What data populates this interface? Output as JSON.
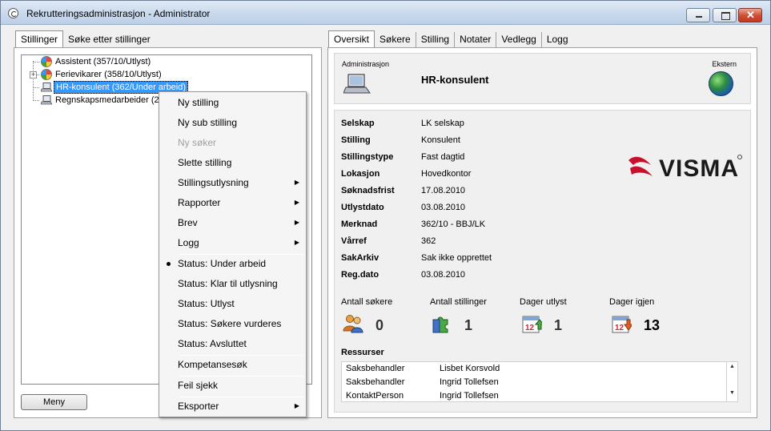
{
  "window": {
    "title": "Rekrutteringsadministrasjon - Administrator"
  },
  "left_tabs": [
    {
      "label": "Stillinger",
      "active": true
    },
    {
      "label": "Søke etter stillinger",
      "active": false
    }
  ],
  "tree": {
    "items": [
      {
        "label": "Assistent (357/10/Utlyst)",
        "icon": "pie-chart-icon",
        "expandable": false,
        "selected": false
      },
      {
        "label": "Ferievikarer (358/10/Utlyst)",
        "icon": "pie-chart-icon",
        "expandable": true,
        "selected": false
      },
      {
        "label": "HR-konsulent (362/Under arbeid)",
        "icon": "laptop-icon",
        "expandable": false,
        "selected": true
      },
      {
        "label": "Regnskapsmedarbeider (26",
        "icon": "laptop-icon",
        "expandable": false,
        "selected": false
      }
    ]
  },
  "meny_button": "Meny",
  "context_menu": {
    "items": [
      {
        "label": "Ny stilling",
        "disabled": false,
        "submenu": false
      },
      {
        "label": "Ny sub stilling",
        "disabled": false,
        "submenu": false
      },
      {
        "label": "Ny søker",
        "disabled": true,
        "submenu": false
      },
      {
        "label": "Slette stilling",
        "disabled": false,
        "submenu": false
      },
      {
        "label": "Stillingsutlysning",
        "disabled": false,
        "submenu": true
      },
      {
        "label": "Rapporter",
        "disabled": false,
        "submenu": true
      },
      {
        "label": "Brev",
        "disabled": false,
        "submenu": true
      },
      {
        "label": "Logg",
        "disabled": false,
        "submenu": true
      },
      {
        "label": "Status: Under arbeid",
        "disabled": false,
        "submenu": false,
        "checked": true
      },
      {
        "label": "Status: Klar til utlysning",
        "disabled": false,
        "submenu": false
      },
      {
        "label": "Status: Utlyst",
        "disabled": false,
        "submenu": false
      },
      {
        "label": "Status: Søkere vurderes",
        "disabled": false,
        "submenu": false
      },
      {
        "label": "Status: Avsluttet",
        "disabled": false,
        "submenu": false
      },
      {
        "label": "Kompetansesøk",
        "disabled": false,
        "submenu": false
      },
      {
        "label": "Feil sjekk",
        "disabled": false,
        "submenu": false
      },
      {
        "label": "Eksporter",
        "disabled": false,
        "submenu": true
      }
    ]
  },
  "right_tabs": [
    {
      "label": "Oversikt",
      "active": true
    },
    {
      "label": "Søkere",
      "active": false
    },
    {
      "label": "Stilling",
      "active": false
    },
    {
      "label": "Notater",
      "active": false
    },
    {
      "label": "Vedlegg",
      "active": false
    },
    {
      "label": "Logg",
      "active": false
    }
  ],
  "header": {
    "category": "Administrasjon",
    "title": "HR-konsulent",
    "ekstern_label": "Ekstern"
  },
  "details": [
    {
      "key": "Selskap",
      "value": "LK selskap"
    },
    {
      "key": "Stilling",
      "value": "Konsulent"
    },
    {
      "key": "Stillingstype",
      "value": "Fast dagtid"
    },
    {
      "key": "Lokasjon",
      "value": "Hovedkontor"
    },
    {
      "key": "Søknadsfrist",
      "value": "17.08.2010"
    },
    {
      "key": "Utlystdato",
      "value": "03.08.2010"
    },
    {
      "key": "Merknad",
      "value": "362/10 - BBJ/LK"
    },
    {
      "key": "Vårref",
      "value": "362"
    },
    {
      "key": "SakArkiv",
      "value": "Sak ikke opprettet"
    },
    {
      "key": "Reg.dato",
      "value": "03.08.2010"
    }
  ],
  "logo_text": "VISMA",
  "stats": [
    {
      "label": "Antall søkere",
      "value": "0",
      "icon": "people-icon"
    },
    {
      "label": "Antall stillinger",
      "value": "1",
      "icon": "puzzle-icon"
    },
    {
      "label": "Dager utlyst",
      "value": "1",
      "icon": "calendar-up-icon"
    },
    {
      "label": "Dager igjen",
      "value": "13",
      "icon": "calendar-down-icon"
    }
  ],
  "ressurser": {
    "label": "Ressurser",
    "rows": [
      {
        "role": "Saksbehandler",
        "name": "Lisbet Korsvold"
      },
      {
        "role": "Saksbehandler",
        "name": "Ingrid Tollefsen"
      },
      {
        "role": "KontaktPerson",
        "name": "Ingrid Tollefsen"
      }
    ]
  },
  "colors": {
    "selection": "#3399ff",
    "visma_red": "#c8102e",
    "window_frame": "#c8d8ec"
  }
}
